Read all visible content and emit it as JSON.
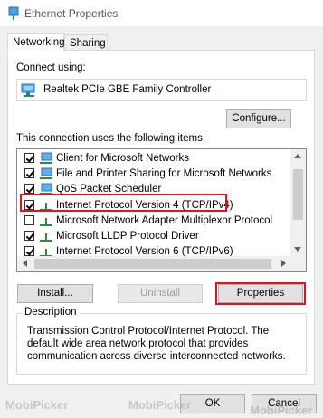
{
  "window": {
    "title": "Ethernet Properties",
    "icon": "network-adapter-icon"
  },
  "tabs": [
    {
      "label": "Networking",
      "active": true
    },
    {
      "label": "Sharing",
      "active": false
    }
  ],
  "connect_using": {
    "label": "Connect using:",
    "adapter_name": "Realtek PCIe GBE Family Controller",
    "configure_button": "Configure..."
  },
  "items_section": {
    "label": "This connection uses the following items:",
    "items": [
      {
        "label": "Client for Microsoft Networks",
        "checked": true,
        "icon": "network-client-icon"
      },
      {
        "label": "File and Printer Sharing for Microsoft Networks",
        "checked": true,
        "icon": "network-client-icon"
      },
      {
        "label": "QoS Packet Scheduler",
        "checked": true,
        "icon": "network-client-icon"
      },
      {
        "label": "Internet Protocol Version 4 (TCP/IPv4)",
        "checked": true,
        "icon": "protocol-icon",
        "highlighted": true
      },
      {
        "label": "Microsoft Network Adapter Multiplexor Protocol",
        "checked": false,
        "icon": "protocol-icon"
      },
      {
        "label": "Microsoft LLDP Protocol Driver",
        "checked": true,
        "icon": "protocol-icon"
      },
      {
        "label": "Internet Protocol Version 6 (TCP/IPv6)",
        "checked": true,
        "icon": "protocol-icon"
      }
    ]
  },
  "buttons": {
    "install": "Install...",
    "uninstall": "Uninstall",
    "properties": "Properties",
    "ok": "OK",
    "cancel": "Cancel"
  },
  "description": {
    "legend": "Description",
    "text": "Transmission Control Protocol/Internet Protocol. The default wide area network protocol that provides communication across diverse interconnected networks."
  },
  "watermarks": [
    "MobiPicker",
    "MobiPicker",
    "MobiPicker"
  ],
  "colors": {
    "highlight": "#e0141e",
    "dialog_bg": "#f0f0f0",
    "button_bg": "#e1e1e1"
  }
}
